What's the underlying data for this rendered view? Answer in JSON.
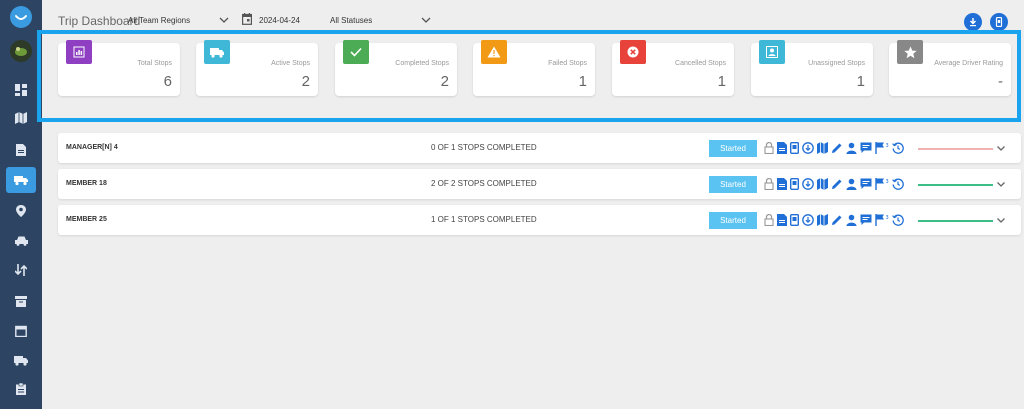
{
  "header": {
    "title": "Trip Dashboard",
    "region_filter": "All Team Regions",
    "date": "2024-04-24",
    "status_filter": "All Statuses"
  },
  "colors": {
    "accent": "#1aa3ef",
    "sidebar": "#2d4562",
    "started_badge": "#5bc3f2",
    "action_icon": "#1f6fd6"
  },
  "sidebar": {
    "items": [
      {
        "icon": "dashboard-icon"
      },
      {
        "icon": "map-icon"
      },
      {
        "icon": "document-icon"
      },
      {
        "icon": "trips-icon",
        "active": true
      },
      {
        "icon": "location-pin-icon"
      },
      {
        "icon": "car-icon"
      },
      {
        "icon": "swap-icon"
      },
      {
        "icon": "archive-icon"
      },
      {
        "icon": "calendar-icon"
      },
      {
        "icon": "truck-icon"
      },
      {
        "icon": "clipboard-icon"
      }
    ]
  },
  "stats": [
    {
      "label": "Total Stops",
      "value": "6",
      "color": "#8e3fc2",
      "icon": "chart-icon"
    },
    {
      "label": "Active Stops",
      "value": "2",
      "color": "#3fb8d8",
      "icon": "truck-icon"
    },
    {
      "label": "Completed Stops",
      "value": "2",
      "color": "#4cab55",
      "icon": "check-icon"
    },
    {
      "label": "Failed Stops",
      "value": "1",
      "color": "#f29a16",
      "icon": "warning-icon"
    },
    {
      "label": "Cancelled Stops",
      "value": "1",
      "color": "#e8433b",
      "icon": "cancel-icon"
    },
    {
      "label": "Unassigned Stops",
      "value": "1",
      "color": "#3fb8d8",
      "icon": "person-icon"
    },
    {
      "label": "Average Driver Rating",
      "value": "-",
      "color": "#888888",
      "icon": "star-icon"
    }
  ],
  "trips": [
    {
      "name": "MANAGER[N] 4",
      "progress": "0 OF 1 STOPS COMPLETED",
      "status": "Started",
      "bar_color": "#f2b1b1"
    },
    {
      "name": "MEMBER 18",
      "progress": "2 OF 2 STOPS COMPLETED",
      "status": "Started",
      "bar_color": "#3cbf86"
    },
    {
      "name": "MEMBER 25",
      "progress": "1 OF 1 STOPS COMPLETED",
      "status": "Started",
      "bar_color": "#3cbf86"
    }
  ],
  "trip_actions": [
    "lock-icon",
    "document-icon",
    "phone-icon",
    "download-icon",
    "map-icon",
    "edit-icon",
    "person-icon",
    "chat-icon",
    "flag-icon",
    "history-icon"
  ]
}
